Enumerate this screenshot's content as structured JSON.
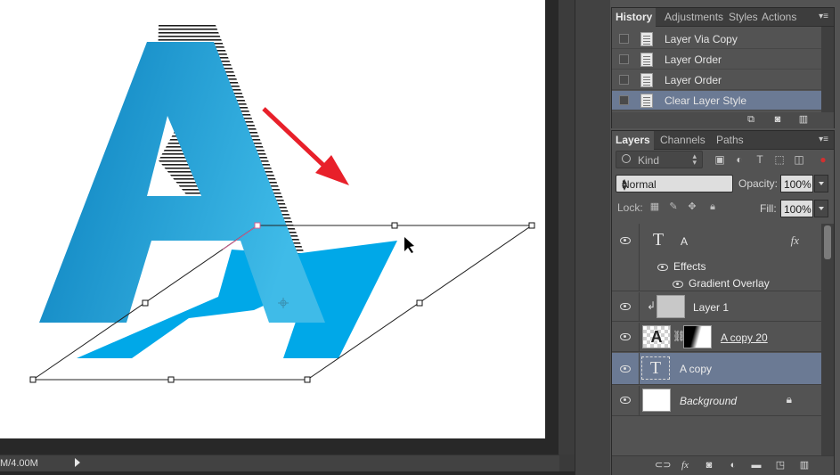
{
  "status_bar": {
    "doc_size": "M/4.00M"
  },
  "history_panel": {
    "tabs": [
      "History",
      "Adjustments",
      "Styles",
      "Actions"
    ],
    "active_tab": "History",
    "items": [
      {
        "label": "Layer Via Copy",
        "selected": false
      },
      {
        "label": "Layer Order",
        "selected": false
      },
      {
        "label": "Layer Order",
        "selected": false
      },
      {
        "label": "Clear Layer Style",
        "selected": true
      }
    ],
    "footer_icons": [
      "new-document-from-state-icon",
      "snapshot-camera-icon",
      "trash-icon"
    ]
  },
  "layers_panel": {
    "tabs": [
      "Layers",
      "Channels",
      "Paths"
    ],
    "active_tab": "Layers",
    "filter_kind": "Kind",
    "filter_icons": [
      "pixel-filter-icon",
      "adjustment-filter-icon",
      "type-filter-icon",
      "shape-filter-icon",
      "smart-object-filter-icon"
    ],
    "blend_mode": "Normal",
    "opacity_label": "Opacity:",
    "opacity_value": "100%",
    "lock_label": "Lock:",
    "lock_icons": [
      "lock-transparent-icon",
      "lock-image-icon",
      "lock-position-icon",
      "lock-all-icon"
    ],
    "fill_label": "Fill:",
    "fill_value": "100%",
    "layers": [
      {
        "name": "A",
        "type": "text",
        "fx": "fx",
        "effects_label": "Effects",
        "effect_item": "Gradient Overlay"
      },
      {
        "name": "Layer 1",
        "type": "pixel"
      },
      {
        "name": "A copy 20",
        "type": "smart-mask"
      },
      {
        "name": "A copy",
        "type": "text",
        "selected": true
      },
      {
        "name": "Background",
        "type": "background",
        "locked": true
      }
    ],
    "footer_icons": [
      "link-layers-icon",
      "fx-icon",
      "add-mask-icon",
      "adjustment-layer-icon",
      "folder-icon",
      "new-layer-icon",
      "trash-icon"
    ]
  },
  "colors": {
    "letter_gradient_start": "#0a82c0",
    "letter_gradient_end": "#3bb7e6",
    "shadow_blue": "#00a8e8",
    "arrow_red": "#e8202a",
    "panel_bg": "#535353",
    "selection_blue": "#6b7a94"
  }
}
